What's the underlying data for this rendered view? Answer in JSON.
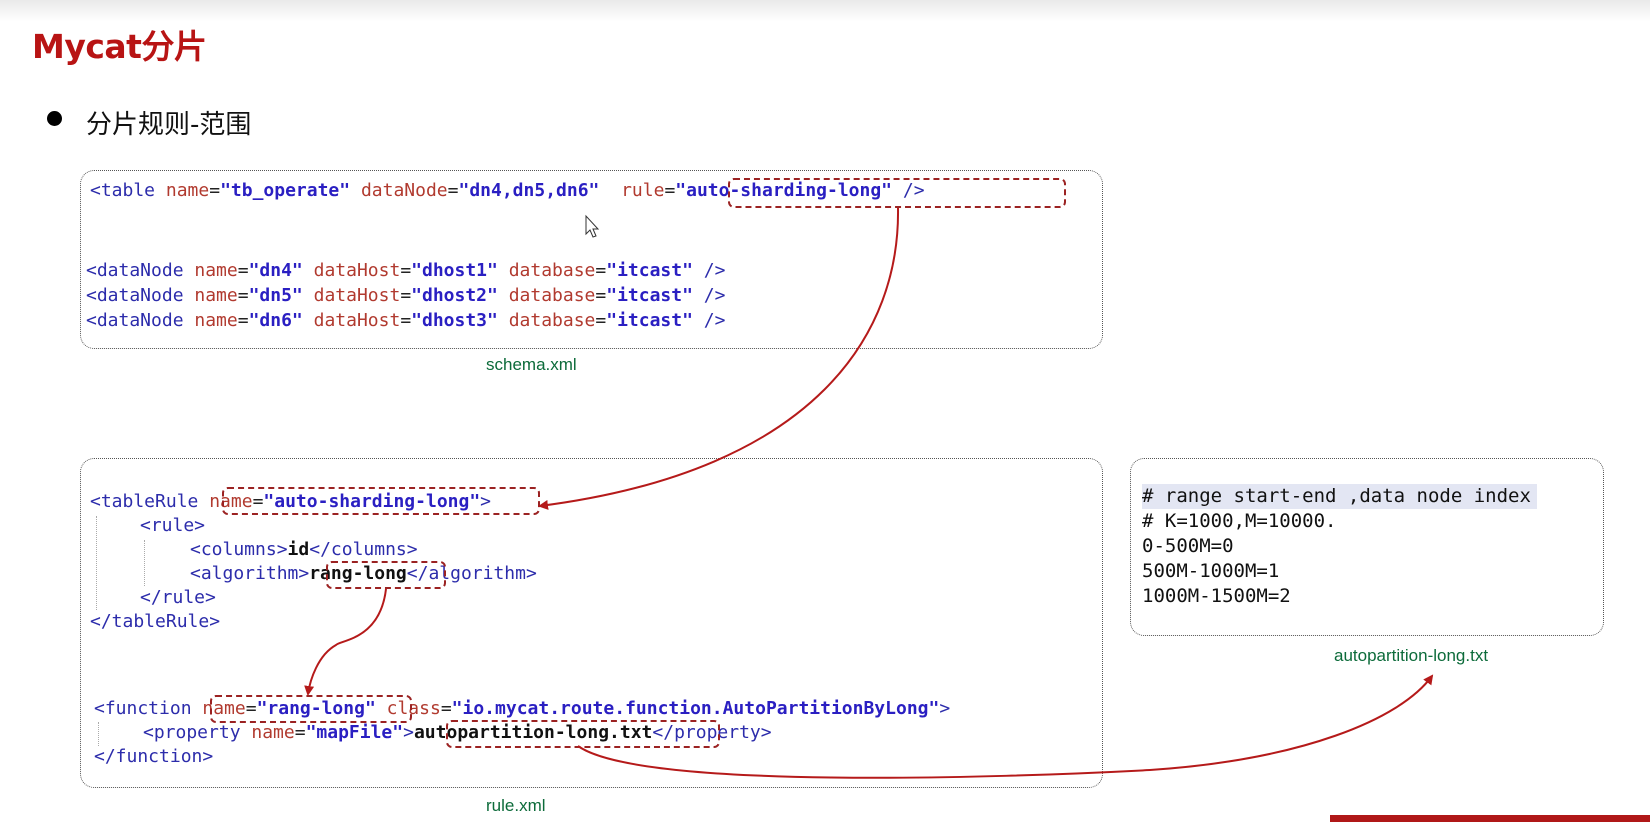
{
  "title": "Mycat分片",
  "bullet": "分片规则-范围",
  "schema": {
    "table_line": {
      "open": "<table ",
      "name_attr": "name",
      "eq1": "=",
      "name_val": "\"tb_operate\"",
      "datanode_attr": " dataNode",
      "eq2": "=",
      "datanode_val": "\"dn4,dn5,dn6\"",
      "rule_attr": "rule",
      "eq3": "=",
      "rule_val": "\"auto-sharding-long\"",
      "close": " />"
    },
    "datanodes": [
      {
        "name": "\"dn4\"",
        "host": "\"dhost1\"",
        "db": "\"itcast\""
      },
      {
        "name": "\"dn5\"",
        "host": "\"dhost2\"",
        "db": "\"itcast\""
      },
      {
        "name": "\"dn6\"",
        "host": "\"dhost3\"",
        "db": "\"itcast\""
      }
    ],
    "datanode_tag": "<dataNode ",
    "name_attr": "name",
    "host_attr": " dataHost",
    "db_attr": " database",
    "eq": "=",
    "close": " />",
    "caption": "schema.xml"
  },
  "rule": {
    "tablerule_open": "<tableRule ",
    "tablerule_name_attr": "name",
    "eq": "=",
    "tablerule_name_val": "\"auto-sharding-long\"",
    "tablerule_close": ">",
    "rule_open": "<rule>",
    "columns_open": "<columns>",
    "columns_val": "id",
    "columns_close": "</columns>",
    "algorithm_open": "<algorithm>",
    "algorithm_val": "rang-long",
    "algorithm_close": "</algorithm>",
    "rule_close": "</rule>",
    "tablerule_end": "</tableRule>",
    "function_open": "<function ",
    "function_name_attr": "name",
    "function_name_val": "\"rang-long\"",
    "function_class_attr": " class",
    "function_class_val": "\"io.mycat.route.function.AutoPartitionByLong\"",
    "function_gt": ">",
    "property_open": "<property ",
    "property_name_attr": "name",
    "property_name_val": "\"mapFile\"",
    "property_gt": ">",
    "property_val": "autopartition-long.txt",
    "property_close": "</property>",
    "function_end": "</function>",
    "caption": "rule.xml"
  },
  "mapfile": {
    "lines": [
      "# range start-end ,data node index",
      "# K=1000,M=10000.",
      "0-500M=0",
      "500M-1000M=1",
      "1000M-1500M=2"
    ],
    "caption": "autopartition-long.txt"
  },
  "colors": {
    "title": "#b81414",
    "arrow": "#b51a1a",
    "caption": "#0c6b3a"
  }
}
